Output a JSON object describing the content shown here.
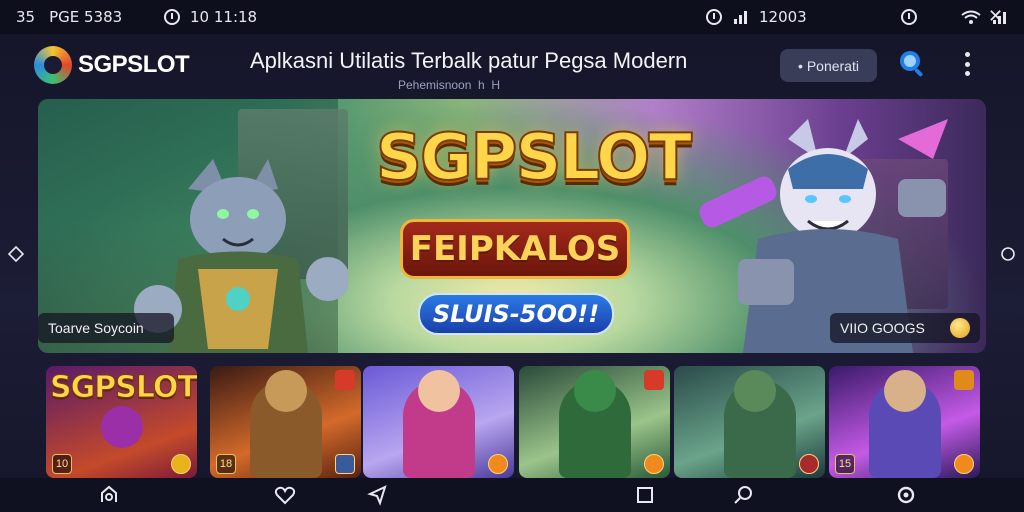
{
  "status_bar": {
    "time": "35",
    "carrier": "PGE 5383",
    "clock": "10 11:18",
    "network_text": "12003",
    "icons": [
      "alarm-icon",
      "signal-icon",
      "power-icon",
      "wifi-icon",
      "battery-icon",
      "close-icon"
    ]
  },
  "header": {
    "logo_text": "SGPSLOT",
    "title": "Aplkasni Utilatis Terbalk patur Pegsa Modern",
    "subtitle": "Pehemisnoon  h  H",
    "button_label": "• Ponerati",
    "search_icon": "search-icon",
    "menu_icon": "more-vertical-icon"
  },
  "banner": {
    "title": "SGPSLOT",
    "plaque": "FEIPKALOS",
    "bonus": "SLUIS-5OO!!",
    "chip_left": "Toarve Soycoin",
    "chip_right": "VIIO GOOGS",
    "colors": {
      "gold": "#ffd64a",
      "plaque": "#a32a1a",
      "bonus": "#2c7be6"
    }
  },
  "thumbnails": [
    {
      "title": "SGPSLOT",
      "badge": "10",
      "theme": "#8a2a8a"
    },
    {
      "title": "",
      "badge": "18",
      "theme": "#c4602a"
    },
    {
      "title": "",
      "badge": "",
      "theme": "#7d6ad6"
    },
    {
      "title": "",
      "badge": "",
      "theme": "#3c8a55"
    },
    {
      "title": "",
      "badge": "",
      "theme": "#3f7a6c"
    },
    {
      "title": "",
      "badge": "15",
      "theme": "#6a3eb5"
    }
  ],
  "bottom_nav": [
    "home-icon",
    "heart-icon",
    "share-icon",
    "square-icon",
    "search-icon",
    "refresh-icon"
  ]
}
